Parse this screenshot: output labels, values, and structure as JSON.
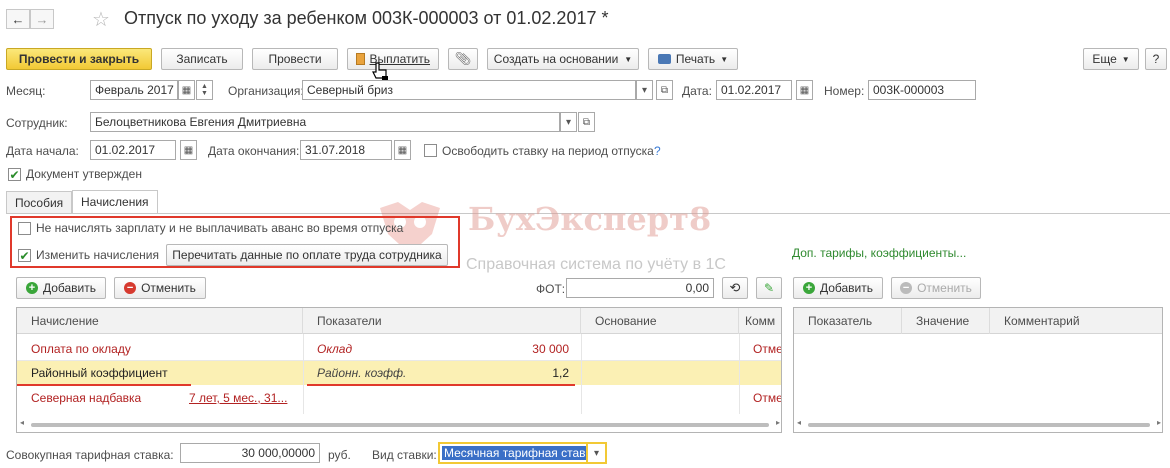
{
  "window": {
    "title": "Отпуск по уходу за ребенком 003К-000003 от 01.02.2017 *",
    "back_glyph": "←",
    "forward_glyph": "→",
    "star_glyph": "☆"
  },
  "toolbar": {
    "post_close": "Провести и закрыть",
    "save": "Записать",
    "post": "Провести",
    "pay": "Выплатить",
    "create_based": "Создать на основании",
    "print": "Печать",
    "more": "Еще",
    "help": "?"
  },
  "form": {
    "month_label": "Месяц:",
    "month_value": "Февраль 2017",
    "org_label": "Организация:",
    "org_value": "Северный бриз",
    "date_label": "Дата:",
    "date_value": "01.02.2017",
    "number_label": "Номер:",
    "number_value": "003К-000003",
    "employee_label": "Сотрудник:",
    "employee_value": "Белоцветникова Евгения Дмитриевна",
    "start_label": "Дата начала:",
    "start_value": "01.02.2017",
    "end_label": "Дата окончания:",
    "end_value": "31.07.2018",
    "free_rate_label": "Освободить ставку на период отпуска",
    "free_rate_help": "?",
    "approved_label": "Документ утвержден"
  },
  "tabs": [
    "Пособия",
    "Начисления"
  ],
  "accruals": {
    "no_salary_label": "Не начислять зарплату и не выплачивать аванс во время отпуска",
    "change_label": "Изменить начисления",
    "recalc_button": "Перечитать данные по оплате труда сотрудника",
    "extra_link": "Доп. тарифы, коэффициенты...",
    "add": "Добавить",
    "cancel": "Отменить",
    "fot_label": "ФОТ:",
    "fot_value": "0,00",
    "columns": [
      "Начисление",
      "Показатели",
      "Основание",
      "Комм"
    ],
    "rows": [
      {
        "name": "Оплата по окладу",
        "detail": "",
        "indicator": "Оклад",
        "value": "30 000",
        "comment": "Отме"
      },
      {
        "name": "Районный коэффициент",
        "detail": "",
        "indicator": "Районн. коэфф.",
        "value": "1,2",
        "comment": ""
      },
      {
        "name": "Северная надбавка",
        "detail": "7 лет, 5 мес., 31...",
        "indicator": "",
        "value": "",
        "comment": "Отме"
      }
    ]
  },
  "right_panel": {
    "add": "Добавить",
    "cancel": "Отменить",
    "columns": [
      "Показатель",
      "Значение",
      "Комментарий"
    ]
  },
  "footer": {
    "total_rate_label": "Совокупная тарифная ставка:",
    "total_rate_value": "30 000,00000",
    "currency": "руб.",
    "rate_kind_label": "Вид ставки:",
    "rate_kind_value": "Месячная тарифная ставк"
  },
  "watermark": {
    "brand": "БухЭксперт8",
    "subtitle": "Справочная система по учёту в 1С"
  },
  "colors": {
    "accent_yellow": "#f2c935",
    "selected_row": "#fbf0b4",
    "annotation_red": "#e0392b",
    "link_green": "#2f8a2f",
    "accrual_red": "#b22222"
  }
}
